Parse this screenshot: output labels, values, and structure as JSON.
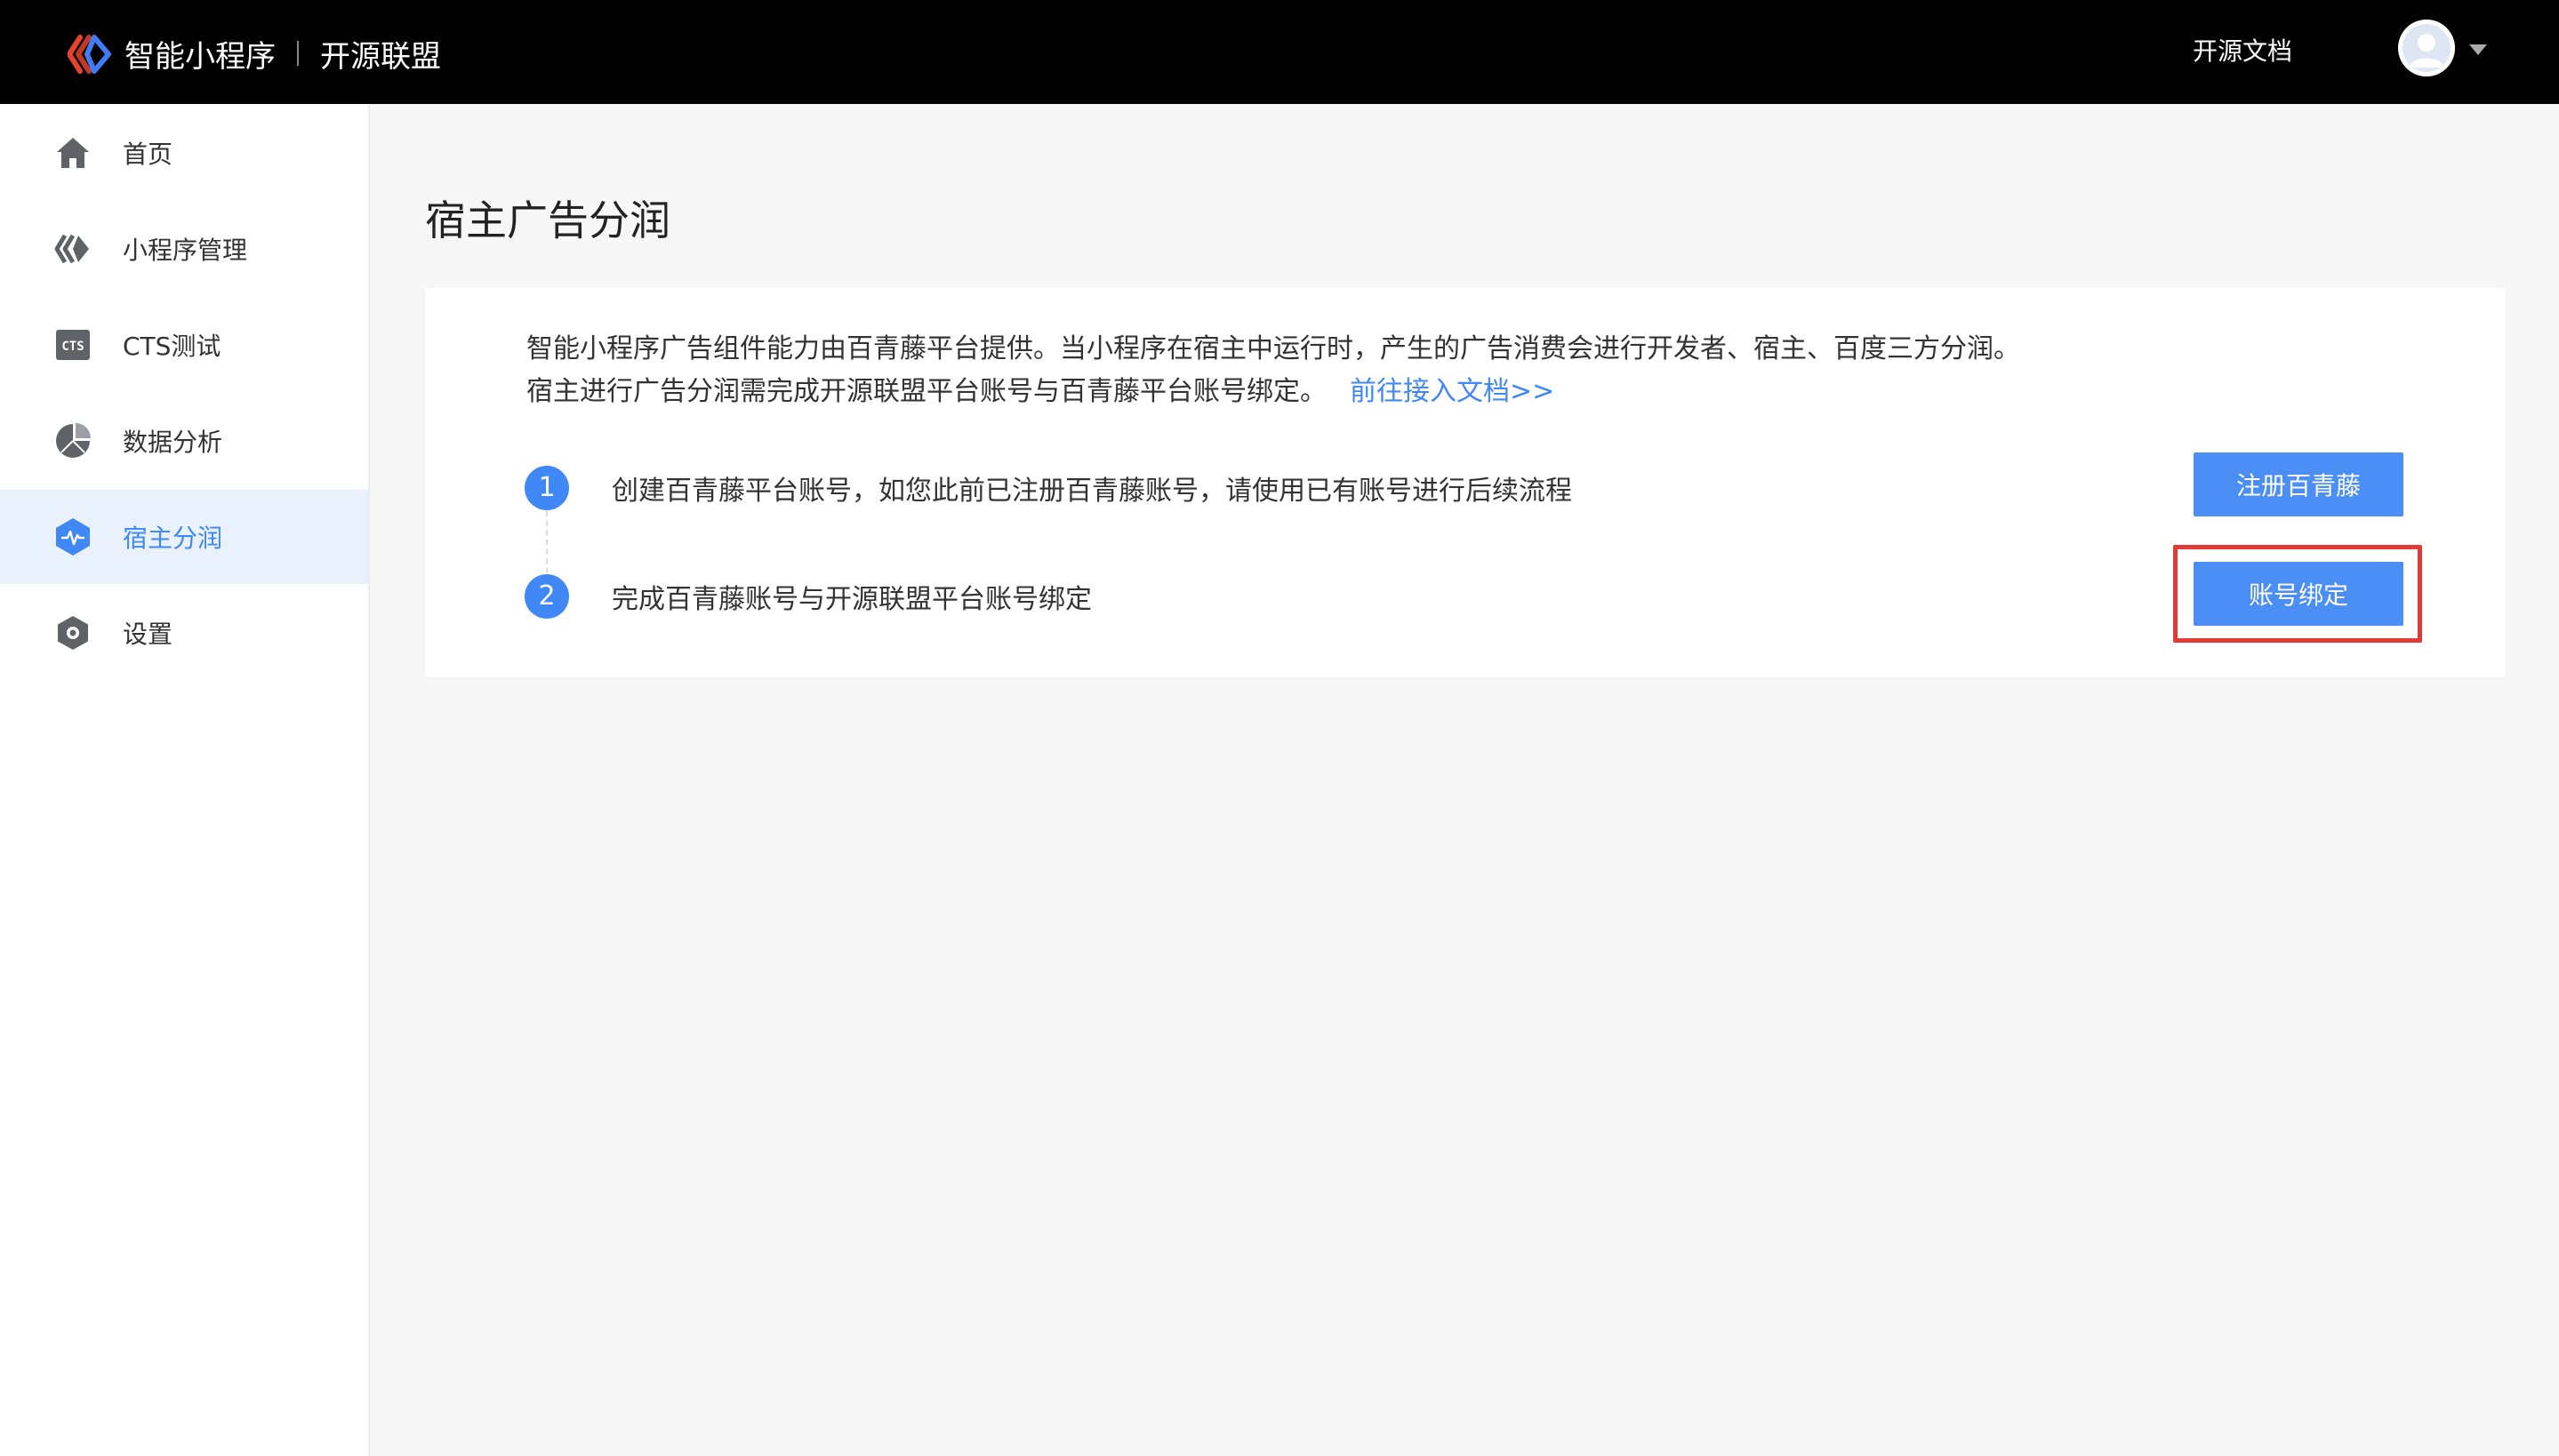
{
  "header": {
    "brand_name": "智能小程序",
    "brand_sub": "开源联盟",
    "docs_link": "开源文档"
  },
  "sidebar": {
    "items": [
      {
        "label": "首页",
        "icon": "home-icon"
      },
      {
        "label": "小程序管理",
        "icon": "miniapp-icon"
      },
      {
        "label": "CTS测试",
        "icon": "cts-icon"
      },
      {
        "label": "数据分析",
        "icon": "pie-chart-icon"
      },
      {
        "label": "宿主分润",
        "icon": "revenue-icon",
        "active": true
      },
      {
        "label": "设置",
        "icon": "settings-icon"
      }
    ]
  },
  "main": {
    "title": "宿主广告分润",
    "description_line1": "智能小程序广告组件能力由百青藤平台提供。当小程序在宿主中运行时，产生的广告消费会进行开发者、宿主、百度三方分润。",
    "description_line2": "宿主进行广告分润需完成开源联盟平台账号与百青藤平台账号绑定。",
    "description_link": "前往接入文档>>",
    "steps": [
      {
        "number": "1",
        "text": "创建百青藤平台账号，如您此前已注册百青藤账号，请使用已有账号进行后续流程",
        "button": "注册百青藤"
      },
      {
        "number": "2",
        "text": "完成百青藤账号与开源联盟平台账号绑定",
        "button": "账号绑定"
      }
    ]
  },
  "colors": {
    "accent": "#3f88f6",
    "topbar": "#000000",
    "highlight": "#e53935"
  }
}
